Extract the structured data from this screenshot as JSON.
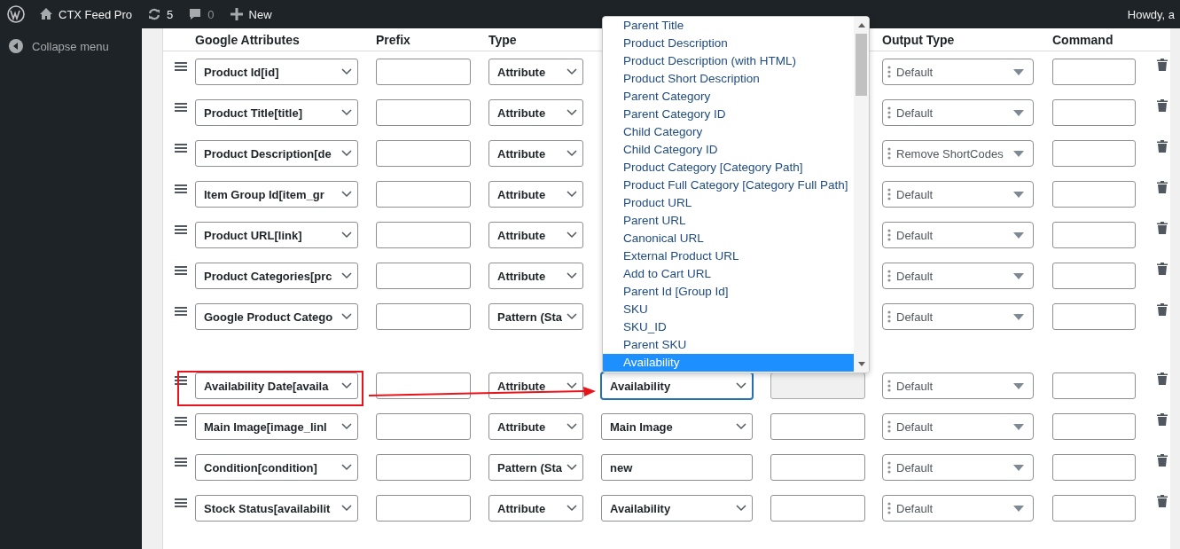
{
  "admin_bar": {
    "site_name": "CTX Feed Pro",
    "updates": "5",
    "comments": "0",
    "new_label": "New",
    "greeting": "Howdy, a"
  },
  "sidebar": {
    "collapse_label": "Collapse menu"
  },
  "table": {
    "columns": [
      "Google Attributes",
      "Prefix",
      "Type",
      "Output Type",
      "Command"
    ],
    "rows": [
      {
        "attribute": "Product Id[id]",
        "type": "Attribute",
        "output_type": "Default",
        "highlighted": false
      },
      {
        "attribute": "Product Title[title]",
        "type": "Attribute",
        "output_type": "Default",
        "highlighted": false
      },
      {
        "attribute": "Product Description[de",
        "type": "Attribute",
        "output_type": "Remove ShortCodes",
        "highlighted": false
      },
      {
        "attribute": "Item Group Id[item_gr",
        "type": "Attribute",
        "output_type": "Default",
        "highlighted": false
      },
      {
        "attribute": "Product URL[link]",
        "type": "Attribute",
        "output_type": "Default",
        "highlighted": false
      },
      {
        "attribute": "Product Categories[prc",
        "type": "Attribute",
        "output_type": "Default",
        "highlighted": false
      },
      {
        "attribute": "Google Product Catego",
        "type": "Pattern (Sta",
        "output_type": "Default",
        "highlighted": false
      }
    ],
    "lower_rows": [
      {
        "attribute": "Availability Date[availa",
        "type": "Attribute",
        "value": {
          "kind": "select",
          "text": "Availability",
          "focused": true
        },
        "suffix_disabled": true,
        "output_type": "Default",
        "highlighted": true
      },
      {
        "attribute": "Main Image[image_linl",
        "type": "Attribute",
        "value": {
          "kind": "select",
          "text": "Main Image",
          "focused": false
        },
        "suffix_disabled": false,
        "output_type": "Default",
        "highlighted": false
      },
      {
        "attribute": "Condition[condition]",
        "type": "Pattern (Sta",
        "value": {
          "kind": "input",
          "text": "new",
          "focused": false
        },
        "suffix_disabled": false,
        "output_type": "Default",
        "highlighted": false
      },
      {
        "attribute": "Stock Status[availabilit",
        "type": "Attribute",
        "value": {
          "kind": "select",
          "text": "Availability",
          "focused": false
        },
        "suffix_disabled": false,
        "output_type": "Default",
        "highlighted": false
      }
    ]
  },
  "value_dropdown": {
    "options": [
      {
        "label": "Parent Title",
        "selected": false
      },
      {
        "label": "Product Description",
        "selected": false
      },
      {
        "label": "Product Description (with HTML)",
        "selected": false
      },
      {
        "label": "Product Short Description",
        "selected": false
      },
      {
        "label": "Parent Category",
        "selected": false
      },
      {
        "label": "Parent Category ID",
        "selected": false
      },
      {
        "label": "Child Category",
        "selected": false
      },
      {
        "label": "Child Category ID",
        "selected": false
      },
      {
        "label": "Product Category [Category Path]",
        "selected": false
      },
      {
        "label": "Product Full Category [Category Full Path]",
        "selected": false
      },
      {
        "label": "Product URL",
        "selected": false
      },
      {
        "label": "Parent URL",
        "selected": false
      },
      {
        "label": "Canonical URL",
        "selected": false
      },
      {
        "label": "External Product URL",
        "selected": false
      },
      {
        "label": "Add to Cart URL",
        "selected": false
      },
      {
        "label": "Parent Id [Group Id]",
        "selected": false
      },
      {
        "label": "SKU",
        "selected": false
      },
      {
        "label": "SKU_ID",
        "selected": false
      },
      {
        "label": "Parent SKU",
        "selected": false
      },
      {
        "label": "Availability",
        "selected": true
      }
    ]
  }
}
